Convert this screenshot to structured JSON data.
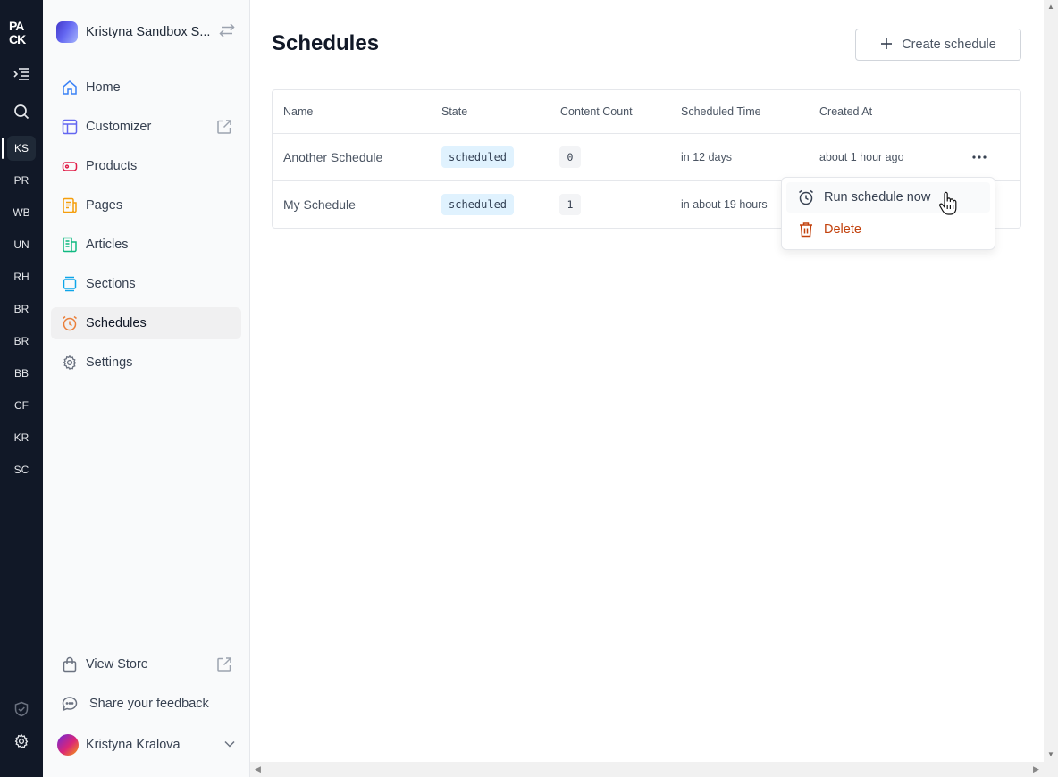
{
  "rail": {
    "logo_text": "PACK",
    "stores": [
      "KS",
      "PR",
      "WB",
      "UN",
      "RH",
      "BR",
      "BR",
      "BB",
      "CF",
      "KR",
      "SC"
    ],
    "active_store": "KS"
  },
  "sidebar": {
    "store_name": "Kristyna Sandbox S...",
    "items": [
      {
        "label": "Home",
        "icon": "home-icon"
      },
      {
        "label": "Customizer",
        "icon": "layout-icon"
      },
      {
        "label": "Products",
        "icon": "tag-icon"
      },
      {
        "label": "Pages",
        "icon": "document-icon"
      },
      {
        "label": "Articles",
        "icon": "newspaper-icon"
      },
      {
        "label": "Sections",
        "icon": "sections-icon"
      },
      {
        "label": "Schedules",
        "icon": "clock-icon"
      },
      {
        "label": "Settings",
        "icon": "gear-icon"
      }
    ],
    "active_item": "Schedules",
    "view_store": "View Store",
    "feedback": "Share your feedback",
    "user_name": "Kristyna Kralova"
  },
  "main": {
    "title": "Schedules",
    "create_button": "Create schedule",
    "table": {
      "columns": [
        "Name",
        "State",
        "Content Count",
        "Scheduled Time",
        "Created At"
      ],
      "rows": [
        {
          "name": "Another Schedule",
          "state": "scheduled",
          "content_count": "0",
          "scheduled_time": "in 12 days",
          "created_at": "about 1 hour ago"
        },
        {
          "name": "My Schedule",
          "state": "scheduled",
          "content_count": "1",
          "scheduled_time": "in about 19 hours",
          "created_at": ""
        }
      ]
    }
  },
  "menu": {
    "items": [
      {
        "label": "Run schedule now",
        "icon": "clock-icon",
        "color": "#374151"
      },
      {
        "label": "Delete",
        "icon": "trash-icon",
        "color": "#c2410c"
      }
    ]
  },
  "colors": {
    "rail_bg": "#111827",
    "badge_bg": "#e0f2fe",
    "delete": "#c2410c",
    "schedules_icon": "#ea7f3a"
  }
}
